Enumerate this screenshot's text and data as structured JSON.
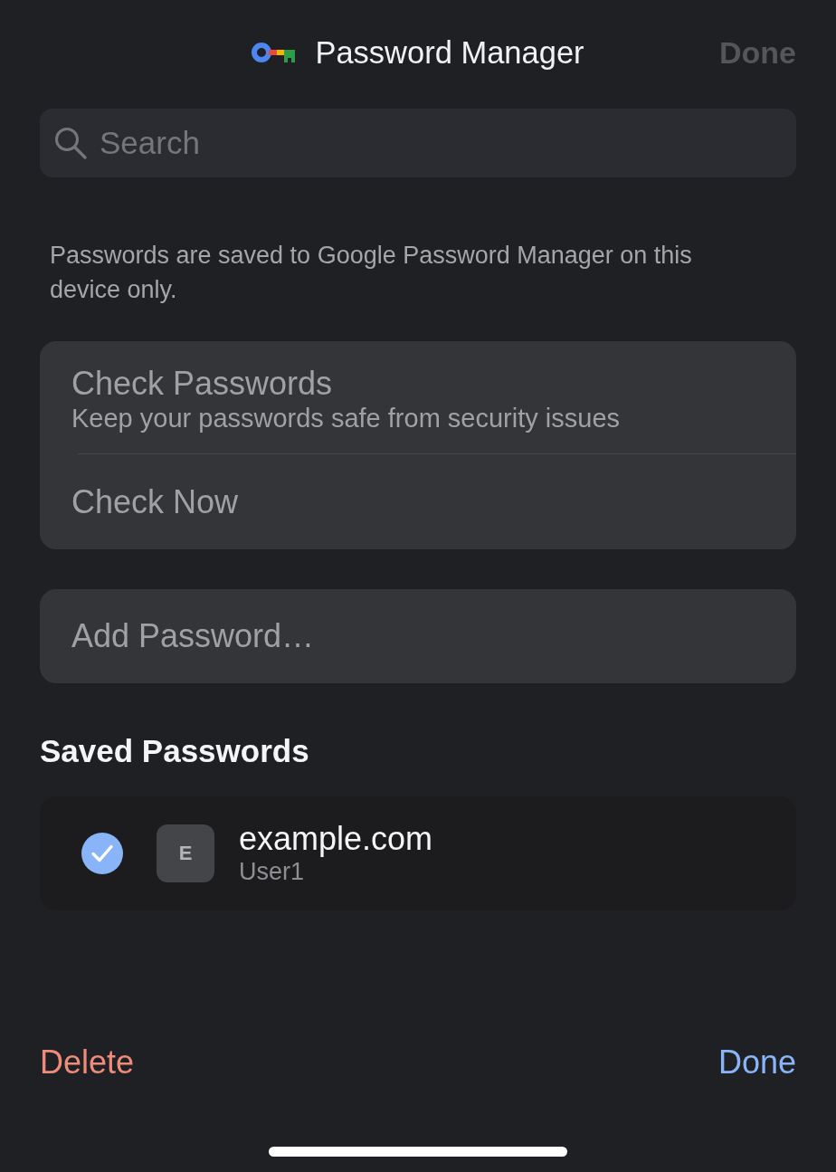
{
  "header": {
    "title": "Password Manager",
    "done": {
      "label": "Done",
      "disabled": true
    }
  },
  "search": {
    "placeholder": "Search"
  },
  "info": "Passwords are saved to Google Password Manager on this device only.",
  "check_card": {
    "title": "Check Passwords",
    "subtitle": "Keep your passwords safe from security issues",
    "action": {
      "label": "Check Now",
      "disabled": true
    }
  },
  "add_password": {
    "label": "Add Password…",
    "disabled": true
  },
  "saved_passwords": {
    "heading": "Saved Passwords",
    "items": [
      {
        "site": "example.com",
        "username": "User1",
        "initial": "E",
        "checked": true
      }
    ]
  },
  "footer": {
    "delete": "Delete",
    "done": "Done"
  }
}
